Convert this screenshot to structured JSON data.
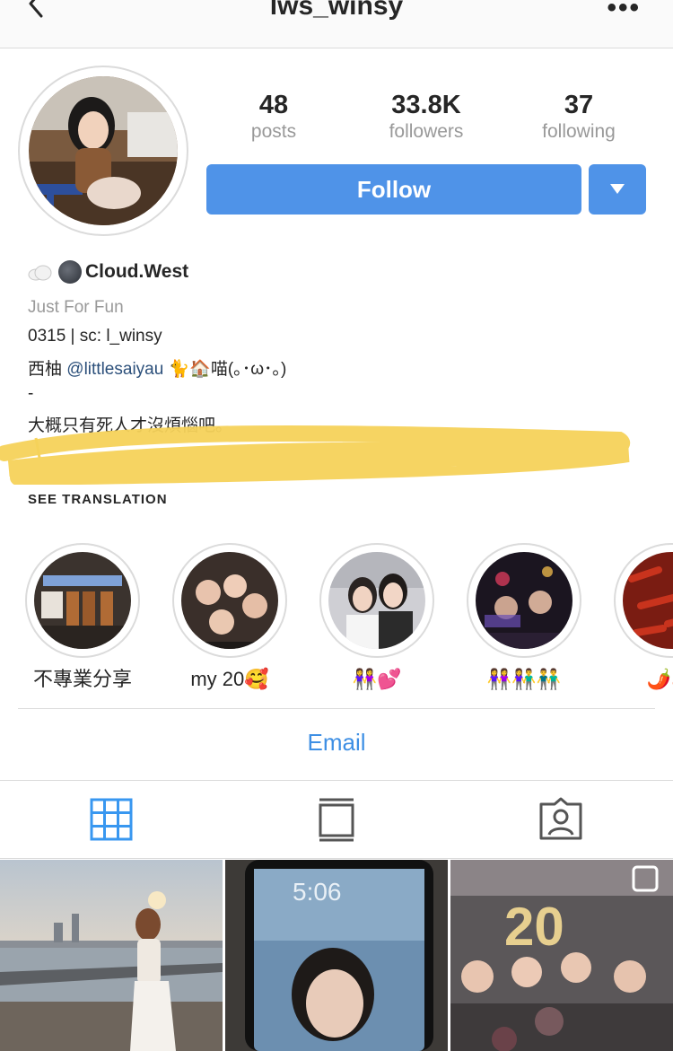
{
  "header": {
    "title": "lws_winsy",
    "more": "•••"
  },
  "profile": {
    "stats": [
      {
        "value": "48",
        "label": "posts"
      },
      {
        "value": "33.8K",
        "label": "followers"
      },
      {
        "value": "37",
        "label": "following"
      }
    ],
    "follow_label": "Follow",
    "display_name": "Cloud.West",
    "category": "Just For Fun",
    "bio_line1": "0315 | sc: l_winsy",
    "bio_line2_prefix": "西柚",
    "bio_line2_mention": "@littlesaiyau",
    "bio_line2_suffix": "🐈🏠喵(｡･ω･｡)",
    "bio_line3": "-",
    "bio_line4": "大概只有死人才沒煩惱吧。",
    "see_translation": "SEE TRANSLATION"
  },
  "highlights": [
    {
      "label": "不專業分享"
    },
    {
      "label": "my 20🥰"
    },
    {
      "label": "👭💕"
    },
    {
      "label": "👭👫👬"
    },
    {
      "label": "🌶️🌶️"
    }
  ],
  "email_label": "Email",
  "colors": {
    "accent": "#4f93e8",
    "link": "#3e8fe4",
    "muted": "#999999",
    "border": "#dbdbdb",
    "scribble": "#f5d25a"
  }
}
